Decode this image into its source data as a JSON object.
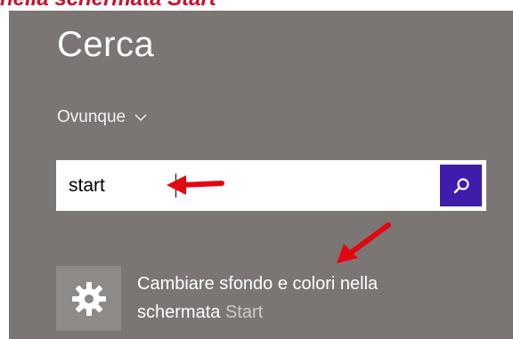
{
  "caption": "nella schermata Start",
  "search_pane": {
    "title": "Cerca",
    "scope": "Ovunque",
    "query": "start"
  },
  "result": {
    "text_main": "Cambiare sfondo e colori nella",
    "text_line2": "schermata",
    "text_highlight": "Start"
  },
  "colors": {
    "panel_bg": "#7b7673",
    "search_button": "#3f1daa",
    "annotation_red": "#e30613"
  }
}
